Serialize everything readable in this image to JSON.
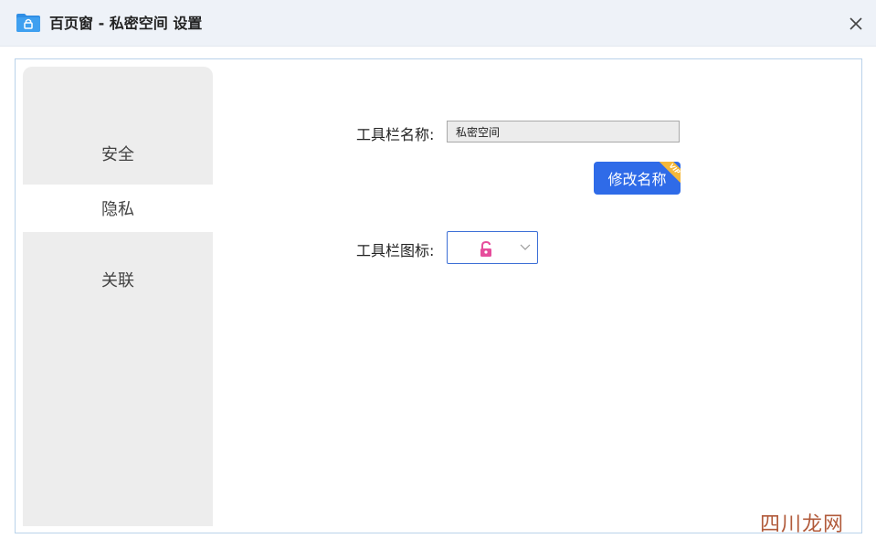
{
  "window": {
    "title": "百页窗 - 私密空间 设置",
    "app_icon": "folder-lock-icon",
    "close_icon": "close-icon"
  },
  "sidebar": {
    "items": [
      {
        "label": "安全",
        "active": false
      },
      {
        "label": "隐私",
        "active": true
      },
      {
        "label": "关联",
        "active": false
      }
    ]
  },
  "form": {
    "name_label": "工具栏名称:",
    "name_value": "私密空间",
    "rename_button": "修改名称",
    "vip_badge": "VIP",
    "icon_label": "工具栏图标:",
    "icon_selected": "lock-open-icon",
    "icon_color": "#e64d9c"
  },
  "watermark": "四川龙网",
  "colors": {
    "accent": "#2f6be8",
    "vip": "#f4b839",
    "titlebar": "#eef2f8",
    "sidebar": "#ededed"
  }
}
